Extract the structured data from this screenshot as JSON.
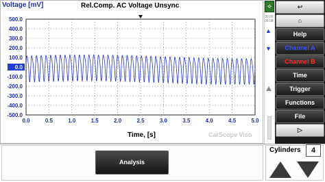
{
  "chart": {
    "title": "Rel.Comp. AC Voltage Unsync",
    "ylabel": "Voltage [mV]",
    "xlabel": "Time, [s]",
    "watermark": "CarScope Viso"
  },
  "chart_data": {
    "type": "line",
    "title": "Rel.Comp. AC Voltage Unsync",
    "xlabel": "Time, [s]",
    "ylabel": "Voltage [mV]",
    "xlim": [
      0.0,
      5.0
    ],
    "ylim": [
      -500.0,
      500.0
    ],
    "x_ticks": [
      "0.0",
      "0.5",
      "1.0",
      "1.5",
      "2.0",
      "2.5",
      "3.0",
      "3.5",
      "4.0",
      "4.5",
      "5.0"
    ],
    "y_ticks": [
      "500.0",
      "400.0",
      "300.0",
      "200.0",
      "100.0",
      "0.0",
      "-100.0",
      "-200.0",
      "-300.0",
      "-400.0",
      "-500.0"
    ],
    "highlighted_y_tick": "0.0",
    "grid": true,
    "series": [
      {
        "color": "#2438c8",
        "waveform": "periodic AC oscillation",
        "cycles_over_5s": 48,
        "peak_mV": 150,
        "trough_mV": -170
      }
    ]
  },
  "status": {
    "time": "00:00\n06:08"
  },
  "menu": [
    {
      "name": "back-button",
      "label": "",
      "icon": "back-arrow-icon",
      "style": "light"
    },
    {
      "name": "home-button",
      "label": "",
      "icon": "home-icon",
      "style": "light"
    },
    {
      "name": "help-button",
      "label": "Help",
      "style": "dark"
    },
    {
      "name": "channel-a-button",
      "label": "Channel A",
      "style": "ch-a"
    },
    {
      "name": "channel-b-button",
      "label": "Channel B",
      "style": "ch-b"
    },
    {
      "name": "time-button",
      "label": "Time",
      "style": "dark"
    },
    {
      "name": "trigger-button",
      "label": "Trigger",
      "style": "dark"
    },
    {
      "name": "functions-button",
      "label": "Functions",
      "style": "dark"
    },
    {
      "name": "file-button",
      "label": "File",
      "style": "dark"
    },
    {
      "name": "play-button",
      "label": "",
      "icon": "play-icon",
      "style": "light"
    }
  ],
  "bottom": {
    "analysis_label": "Analysis",
    "cylinders_label": "Cylinders",
    "cylinders_value": "4"
  },
  "colors": {
    "signal": "#2438c8",
    "axis_text": "#1d2ea8",
    "zero_highlight": "#1f3fd4",
    "menu_bg": "#1c1c1c"
  }
}
